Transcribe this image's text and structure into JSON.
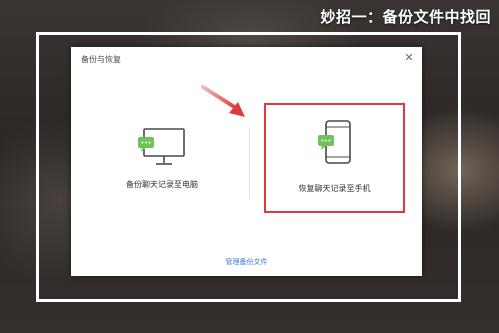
{
  "headline": "妙招一：备份文件中找回",
  "dialog": {
    "title": "备份与恢复",
    "close_glyph": "✕",
    "options": [
      {
        "label": "备份聊天记录至电脑",
        "icon": "monitor-chat-icon",
        "highlighted": false
      },
      {
        "label": "恢复聊天记录至手机",
        "icon": "phone-chat-icon",
        "highlighted": true
      }
    ],
    "manage_link": "管理备份文件"
  },
  "colors": {
    "highlight_border": "#e03a3a",
    "arrow": "#e03a3a",
    "chat_green": "#6fc35a",
    "link_blue": "#3a7bd5"
  }
}
